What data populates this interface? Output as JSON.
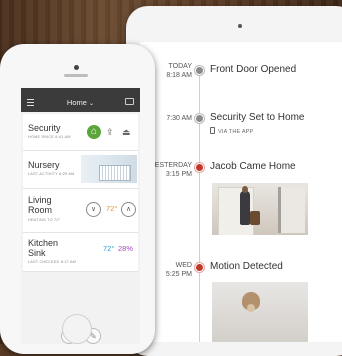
{
  "tablet": {
    "events": [
      {
        "date": "TODAY",
        "time": "8:18 AM",
        "title": "Front Door Opened",
        "sub": ""
      },
      {
        "date": "",
        "time": "7:30 AM",
        "title": "Security Set to Home",
        "sub": "VIA THE APP"
      },
      {
        "date": "YESTERDAY",
        "time": "3:15 PM",
        "title": "Jacob Came Home",
        "sub": ""
      },
      {
        "date": "WED",
        "time": "5:25 PM",
        "title": "Motion Detected",
        "sub": ""
      }
    ]
  },
  "phone": {
    "header_title": "Home",
    "cards": {
      "security": {
        "title": "Security",
        "sub": "HOME SINCE 8:41 AM"
      },
      "nursery": {
        "title": "Nursery",
        "sub": "LAST ACTIVITY 8:29 AM"
      },
      "living": {
        "title_line1": "Living",
        "title_line2": "Room",
        "sub": "HEATING TO 72°",
        "temp": "72°"
      },
      "kitchen": {
        "title_line1": "Kitchen",
        "title_line2": "Sink",
        "sub": "LAST CHECKED 8:17 AM",
        "temp": "72°",
        "humidity": "28%"
      }
    }
  },
  "colors": {
    "accent_green": "#5aa63a",
    "alert_red": "#c0392b",
    "temp_orange": "#f0922e",
    "temp_blue": "#2f9fcf",
    "humidity_purple": "#9b4dbf"
  }
}
